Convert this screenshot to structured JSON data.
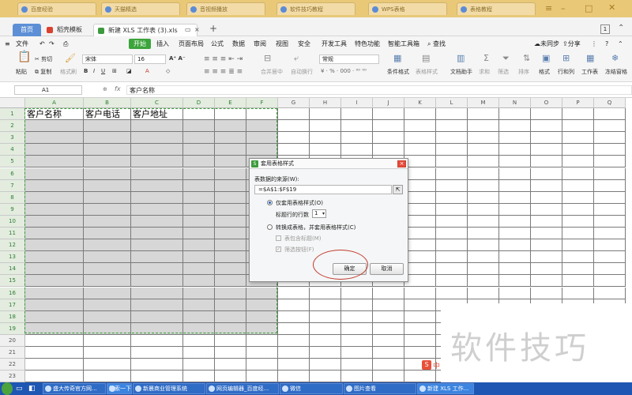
{
  "browser_tabs": [
    "百度经验",
    "天猫精选",
    "百度知道",
    "音视频播放",
    "软件技巧教程",
    "WPS表格",
    "表格教程"
  ],
  "window": {
    "home_tab": "首页",
    "wps_tab": "稻壳模板",
    "doc_tab": "新建 XLS 工作表 (3).xls",
    "new_tab_symbol": "+",
    "badge": "1"
  },
  "menu": {
    "file": "文件",
    "start": "开始",
    "items": [
      "插入",
      "页面布局",
      "公式",
      "数据",
      "审阅",
      "视图",
      "安全",
      "开发工具",
      "特色功能",
      "智能工具箱"
    ],
    "search": "查找",
    "sync": "未同步",
    "share": "分享"
  },
  "ribbon": {
    "paste": "粘贴",
    "cut": "剪切",
    "copy": "复制",
    "format_painter": "格式刷",
    "font": "宋体",
    "font_size": "16",
    "merge": "合并居中",
    "wrap": "自动换行",
    "number_format": "常规",
    "conditional": "条件格式",
    "table_style": "表格样式",
    "doc_helper": "文档助手",
    "sum": "求和",
    "filter": "筛选",
    "sort": "排序",
    "format": "格式",
    "rows_cols": "行和列",
    "worksheet": "工作表",
    "freeze": "冻结窗格"
  },
  "formula_bar": {
    "cell_ref": "A1",
    "fx": "fx",
    "content": "客户名称"
  },
  "sheet": {
    "columns": [
      "A",
      "B",
      "C",
      "D",
      "E",
      "F",
      "G",
      "H",
      "I",
      "J",
      "K",
      "L",
      "M",
      "N",
      "O",
      "P",
      "Q"
    ],
    "rows": [
      "1",
      "2",
      "3",
      "4",
      "5",
      "6",
      "7",
      "8",
      "9",
      "10",
      "11",
      "12",
      "13",
      "14",
      "15",
      "16",
      "17",
      "18",
      "19",
      "20",
      "21",
      "22",
      "23"
    ],
    "headers": [
      "客户名称",
      "客户电话",
      "客户地址"
    ]
  },
  "dialog": {
    "title": "套用表格样式",
    "source_label": "表数据的来源(W):",
    "source_value": "=$A$1:$F$19",
    "option1": "仅套用表格样式(O)",
    "header_rows_label": "标题行的行数",
    "header_rows_value": "1",
    "option2": "转换成表格，并套用表格样式(C)",
    "check1": "表包含标题(M)",
    "check2": "筛选按钮(F)",
    "ok": "确定",
    "cancel": "取消"
  },
  "watermark": {
    "text": "软件技巧",
    "logo_text": "中"
  },
  "taskbar": {
    "items": [
      "盛大传奇官方网...",
      "搜索一下",
      "新晨商业管理系统",
      "网页编辑器_百度经...",
      "微信",
      "图片查看",
      "新建 XLS 工作..."
    ]
  }
}
